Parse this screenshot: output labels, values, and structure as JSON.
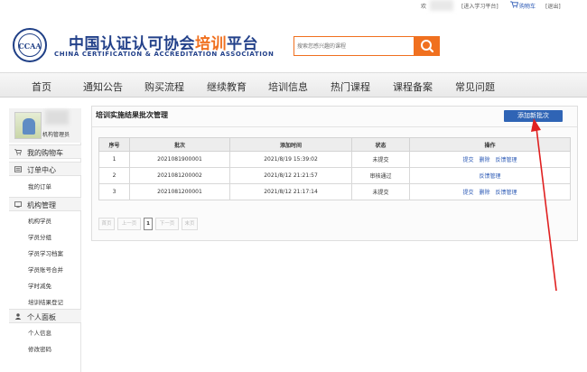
{
  "topbar": {
    "welcome": "欢",
    "study_link": "[进入学习平台]",
    "cart_link": "购物车",
    "logout_link": "[退出]"
  },
  "header": {
    "seal_text": "CCAA",
    "title_main": "中国认证认可协会",
    "title_highlight": "培训",
    "title_tail": "平台",
    "subtitle": "CHINA CERTIFICATION & ACCREDITATION ASSOCIATION",
    "search_placeholder": "搜索您感兴趣的课程"
  },
  "nav": [
    "首页",
    "通知公告",
    "购买流程",
    "继续教育",
    "培训信息",
    "热门课程",
    "课程备案",
    "常见问题"
  ],
  "sidebar": {
    "profile_name": "机构管理员",
    "cart": "我的购物车",
    "order_center": "订单中心",
    "my_orders": "我的订单",
    "org_manage": "机构管理",
    "org_links": [
      "机构学员",
      "学员分组",
      "学员学习档案",
      "学员账号合并",
      "学时减免",
      "培训结果登记"
    ],
    "personal_panel": "个人面板",
    "personal_links": [
      "个人信息",
      "修改密码"
    ]
  },
  "panel": {
    "title": "培训实施结果批次管理",
    "add_button": "添加新批次"
  },
  "table": {
    "headers": [
      "序号",
      "批次",
      "添加时间",
      "状态",
      "操作"
    ],
    "rows": [
      {
        "idx": "1",
        "batch": "2021081900001",
        "time": "2021/8/19 15:39:02",
        "status": "未提交",
        "actions": [
          "提交",
          "删除",
          "反馈管理"
        ]
      },
      {
        "idx": "2",
        "batch": "2021081200002",
        "time": "2021/8/12 21:21:57",
        "status": "审核通过",
        "actions": [
          "反馈管理"
        ]
      },
      {
        "idx": "3",
        "batch": "2021081200001",
        "time": "2021/8/12 21:17:14",
        "status": "未提交",
        "actions": [
          "提交",
          "删除",
          "反馈管理"
        ]
      }
    ]
  },
  "pager": {
    "first": "首页",
    "prev": "上一页",
    "current": "1",
    "next": "下一页",
    "last": "末页"
  },
  "colors": {
    "brand_blue": "#23418a",
    "accent_orange": "#f0701f",
    "button_blue": "#2f64b5",
    "annotation_red": "#e02020"
  }
}
